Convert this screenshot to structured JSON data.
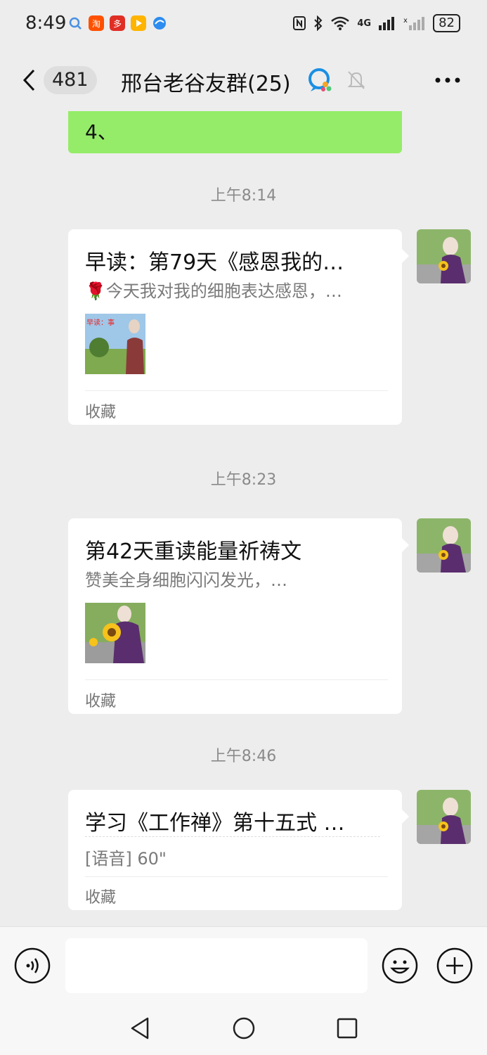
{
  "status_bar": {
    "time": "8:49",
    "apps": [
      "search-app-icon",
      "taobao-app-icon",
      "pinduoduo-app-icon",
      "video-app-icon",
      "browser-app-icon"
    ],
    "network": "4G",
    "battery": "82"
  },
  "header": {
    "unread_count": "481",
    "title": "邢台老谷友群(25)"
  },
  "messages": {
    "partial_bubble_text": "4、",
    "items": [
      {
        "time": "上午8:14",
        "title": "早读：第79天《感恩我的…",
        "subtitle": "🌹今天我对我的细胞表达感恩，…",
        "thumb_caption": "早读：事",
        "footer": "收藏"
      },
      {
        "time": "上午8:23",
        "title": "第42天重读能量祈祷文",
        "subtitle": "赞美全身细胞闪闪发光，…",
        "footer": "收藏"
      },
      {
        "time": "上午8:46",
        "title": "学习《工作禅》第十五式 …",
        "subtitle": "[语音] 60\"",
        "footer": "收藏"
      }
    ]
  },
  "colors": {
    "sent_bubble": "#95ec69",
    "background": "#ededed",
    "card": "#ffffff"
  }
}
